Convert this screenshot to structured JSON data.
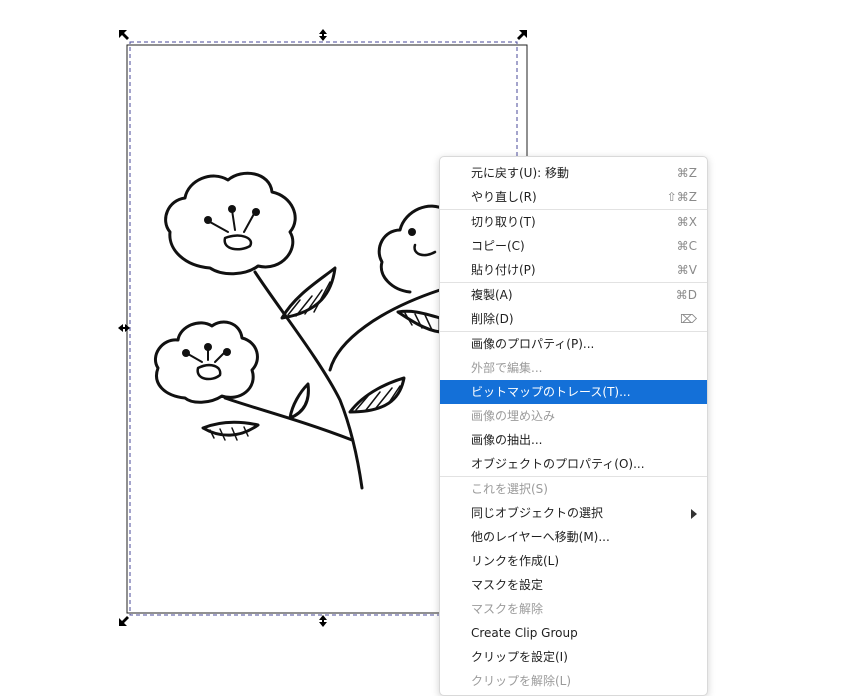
{
  "context_menu": {
    "items": [
      {
        "label": "元に戻す(U): 移動",
        "shortcut": "⌘Z",
        "disabled": false
      },
      {
        "label": "やり直し(R)",
        "shortcut": "⇧⌘Z",
        "disabled": false
      },
      {
        "label": "切り取り(T)",
        "shortcut": "⌘X",
        "disabled": false
      },
      {
        "label": "コピー(C)",
        "shortcut": "⌘C",
        "disabled": false
      },
      {
        "label": "貼り付け(P)",
        "shortcut": "⌘V",
        "disabled": false
      },
      {
        "label": "複製(A)",
        "shortcut": "⌘D",
        "disabled": false
      },
      {
        "label": "削除(D)",
        "shortcut": "⌦",
        "disabled": false
      },
      {
        "label": "画像のプロパティ(P)...",
        "shortcut": "",
        "disabled": false
      },
      {
        "label": "外部で編集...",
        "shortcut": "",
        "disabled": true
      },
      {
        "label": "ビットマップのトレース(T)...",
        "shortcut": "",
        "disabled": false,
        "selected": true
      },
      {
        "label": "画像の埋め込み",
        "shortcut": "",
        "disabled": true
      },
      {
        "label": "画像の抽出...",
        "shortcut": "",
        "disabled": false
      },
      {
        "label": "オブジェクトのプロパティ(O)...",
        "shortcut": "",
        "disabled": false
      },
      {
        "label": "これを選択(S)",
        "shortcut": "",
        "disabled": true
      },
      {
        "label": "同じオブジェクトの選択",
        "shortcut": "",
        "disabled": false,
        "submenu": true
      },
      {
        "label": "他のレイヤーへ移動(M)...",
        "shortcut": "",
        "disabled": false
      },
      {
        "label": "リンクを作成(L)",
        "shortcut": "",
        "disabled": false
      },
      {
        "label": "マスクを設定",
        "shortcut": "",
        "disabled": false
      },
      {
        "label": "マスクを解除",
        "shortcut": "",
        "disabled": true
      },
      {
        "label": "Create Clip Group",
        "shortcut": "",
        "disabled": false
      },
      {
        "label": "クリップを設定(I)",
        "shortcut": "",
        "disabled": false
      },
      {
        "label": "クリップを解除(L)",
        "shortcut": "",
        "disabled": true
      }
    ]
  },
  "colors": {
    "selection": "#1470d8",
    "disabled_text": "#9b9b9b",
    "selection_dash": "#3b3b8f"
  }
}
